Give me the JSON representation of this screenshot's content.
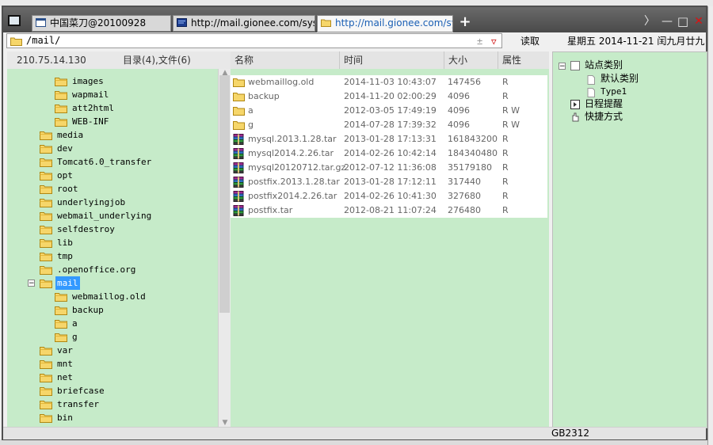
{
  "tabs": [
    {
      "label": "中国菜刀@20100928",
      "active": false
    },
    {
      "label": "http://mail.gionee.com/syste...",
      "active": false
    },
    {
      "label": "http://mail.gionee.com/syste...",
      "active": true
    }
  ],
  "window_controls": {
    "next": "〉",
    "minimize": "—",
    "maximize": "□",
    "close": "✕"
  },
  "address": {
    "path": "/mail/",
    "pm_glyph": "±",
    "dropdown_glyph": "▽",
    "read_label": "读取",
    "date": "星期五 2014-11-21 闰九月廿九"
  },
  "left_header": {
    "ip": "210.75.14.130",
    "counts": "目录(4),文件(6)"
  },
  "tree": [
    {
      "label": "images",
      "level": 2
    },
    {
      "label": "wapmail",
      "level": 2
    },
    {
      "label": "att2html",
      "level": 2
    },
    {
      "label": "WEB-INF",
      "level": 2
    },
    {
      "label": "media",
      "level": 1
    },
    {
      "label": "dev",
      "level": 1
    },
    {
      "label": "Tomcat6.0_transfer",
      "level": 1
    },
    {
      "label": "opt",
      "level": 1
    },
    {
      "label": "root",
      "level": 1
    },
    {
      "label": "underlyingjob",
      "level": 1
    },
    {
      "label": "webmail_underlying",
      "level": 1
    },
    {
      "label": "selfdestroy",
      "level": 1
    },
    {
      "label": "lib",
      "level": 1
    },
    {
      "label": "tmp",
      "level": 1
    },
    {
      "label": ".openoffice.org",
      "level": 1
    },
    {
      "label": "mail",
      "level": 1,
      "selected": true,
      "expander": "−"
    },
    {
      "label": "webmaillog.old",
      "level": 2
    },
    {
      "label": "backup",
      "level": 2
    },
    {
      "label": "a",
      "level": 2
    },
    {
      "label": "g",
      "level": 2
    },
    {
      "label": "var",
      "level": 1
    },
    {
      "label": "mnt",
      "level": 1
    },
    {
      "label": "net",
      "level": 1
    },
    {
      "label": "briefcase",
      "level": 1
    },
    {
      "label": "transfer",
      "level": 1
    },
    {
      "label": "bin",
      "level": 1
    }
  ],
  "file_columns": [
    "名称",
    "时间",
    "大小",
    "属性"
  ],
  "files": [
    {
      "name": "webmaillog.old",
      "time": "2014-11-03 10:43:07",
      "size": "147456",
      "attr": "R",
      "type": "folder"
    },
    {
      "name": "backup",
      "time": "2014-11-20 02:00:29",
      "size": "4096",
      "attr": "R",
      "type": "folder"
    },
    {
      "name": "a",
      "time": "2012-03-05 17:49:19",
      "size": "4096",
      "attr": "R W",
      "type": "folder"
    },
    {
      "name": "g",
      "time": "2014-07-28 17:39:32",
      "size": "4096",
      "attr": "R W",
      "type": "folder"
    },
    {
      "name": "mysql.2013.1.28.tar",
      "time": "2013-01-28 17:13:31",
      "size": "161843200",
      "attr": "R",
      "type": "archive"
    },
    {
      "name": "mysql2014.2.26.tar",
      "time": "2014-02-26 10:42:14",
      "size": "184340480",
      "attr": "R",
      "type": "archive"
    },
    {
      "name": "mysql20120712.tar.gz",
      "time": "2012-07-12 11:36:08",
      "size": "35179180",
      "attr": "R",
      "type": "archive"
    },
    {
      "name": "postfix.2013.1.28.tar",
      "time": "2013-01-28 17:12:11",
      "size": "317440",
      "attr": "R",
      "type": "archive"
    },
    {
      "name": "postfix2014.2.26.tar",
      "time": "2014-02-26 10:41:30",
      "size": "327680",
      "attr": "R",
      "type": "archive"
    },
    {
      "name": "postfix.tar",
      "time": "2012-08-21 11:07:24",
      "size": "276480",
      "attr": "R",
      "type": "archive"
    }
  ],
  "right_tree": {
    "root": {
      "label": "站点类别",
      "expander": "−"
    },
    "children": [
      "默认类别",
      "Type1"
    ],
    "items": [
      "日程提醒",
      "快捷方式"
    ]
  },
  "status": {
    "encoding": "GB2312"
  },
  "colors": {
    "pane_bg": "#c6ebc9",
    "selection": "#3399ff",
    "active_tab_text": "#1a5fb4",
    "close": "#cc0000"
  }
}
